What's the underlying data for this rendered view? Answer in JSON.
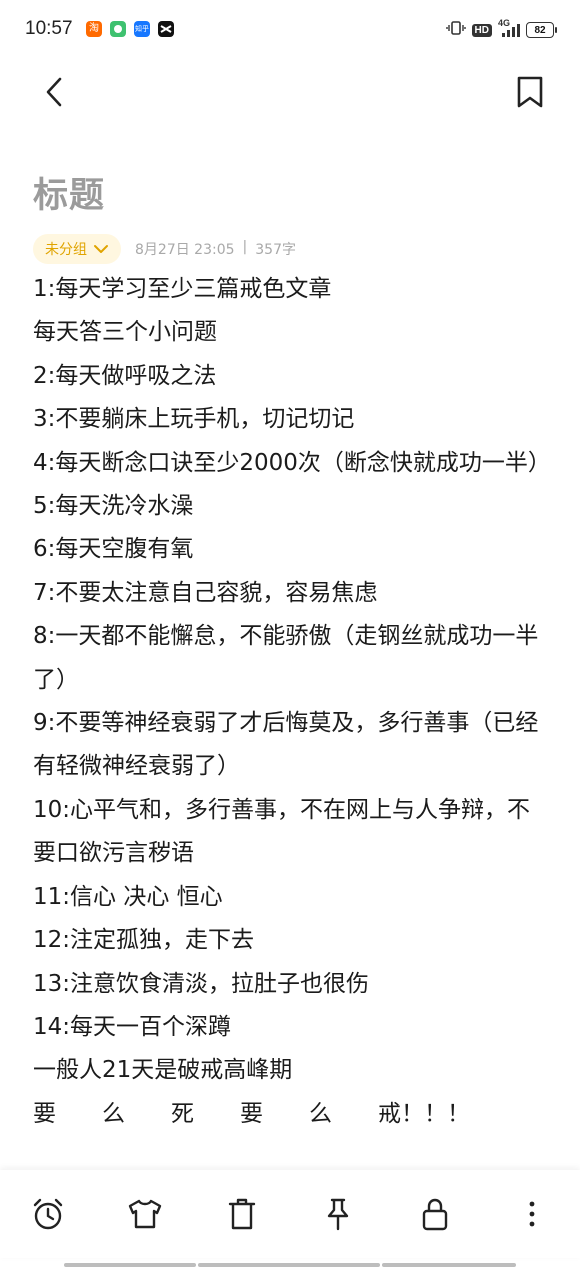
{
  "status_bar": {
    "time": "10:57",
    "apps": [
      {
        "name": "taobao-icon",
        "glyph": "淘",
        "color": "#ff6a00"
      },
      {
        "name": "app2-icon",
        "glyph": "",
        "color": "#3ec16f"
      },
      {
        "name": "zhihu-icon",
        "glyph": "知乎",
        "color": "#1677ff"
      },
      {
        "name": "capcut-icon",
        "glyph": "",
        "color": "#111111"
      }
    ],
    "hd": "HD",
    "network": "4G",
    "battery": "82"
  },
  "header": {
    "back": "back",
    "bookmark": "bookmark"
  },
  "note": {
    "title": "标题",
    "group": "未分组",
    "date": "8月27日 23:05",
    "separator": "|",
    "word_count": "357字",
    "lines": [
      "1:每天学习至少三篇戒色文章",
      "每天答三个小问题",
      "2:每天做呼吸之法",
      "3:不要躺床上玩手机，切记切记",
      "4:每天断念口诀至少2000次（断念快就成功一半）",
      "5:每天洗冷水澡",
      "6:每天空腹有氧",
      "7:不要太注意自己容貌，容易焦虑",
      "8:一天都不能懈怠，不能骄傲（走钢丝就成功一半了）",
      "9:不要等神经衰弱了才后悔莫及，多行善事（已经有轻微神经衰弱了）",
      "10:心平气和，多行善事，不在网上与人争辩，不要口欲污言秽语",
      "11:信心 决心 恒心",
      "12:注定孤独，走下去",
      "13:注意饮食清淡，拉肚子也很伤",
      "14:每天一百个深蹲",
      "一般人21天是破戒高峰期",
      "要　　么　　死　　要　　么　　戒！！！"
    ]
  },
  "toolbar": {
    "items": [
      "alarm-icon",
      "shirt-icon",
      "trash-icon",
      "pin-icon",
      "lock-icon",
      "more-icon"
    ]
  },
  "colors": {
    "accent": "#e0a400",
    "accent_bg": "#fff7e0",
    "title": "#9b9b9b"
  }
}
